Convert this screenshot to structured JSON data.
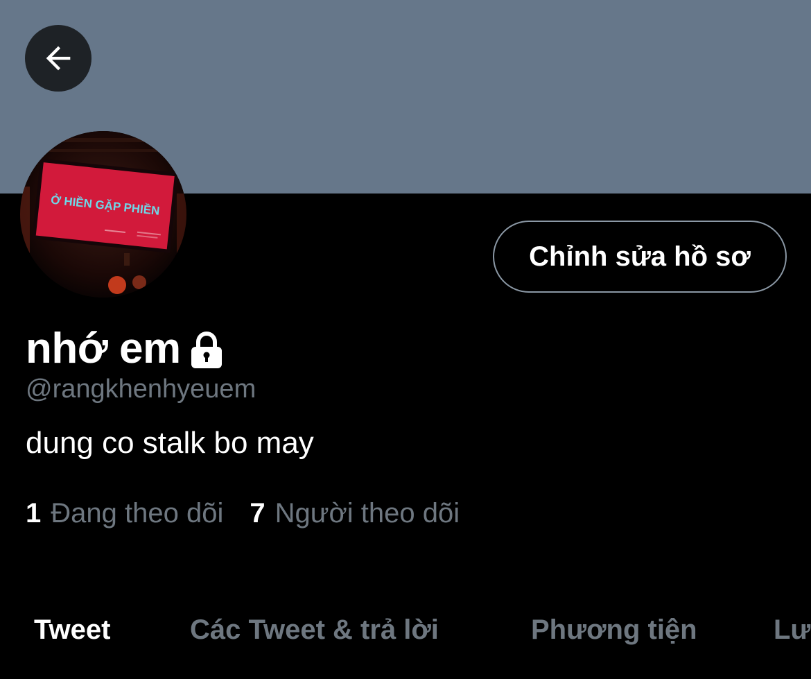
{
  "profile": {
    "display_name": "nhớ em",
    "handle": "@rangkhenhyeuem",
    "bio": "dung co stalk bo may",
    "protected_icon": "lock-icon",
    "avatar_sign_text": "Ở HIỀN GẶP PHIỀN"
  },
  "header": {
    "back_icon": "arrow-left-icon",
    "banner_color": "#66778a"
  },
  "actions": {
    "edit_profile_label": "Chỉnh sửa hồ sơ"
  },
  "stats": {
    "following_count": "1",
    "following_label": "Đang theo dõi",
    "followers_count": "7",
    "followers_label": "Người theo dõi"
  },
  "tabs": [
    {
      "label": "Tweet",
      "active": true
    },
    {
      "label": "Các Tweet & trả lời",
      "active": false
    },
    {
      "label": "Phương tiện",
      "active": false
    },
    {
      "label": "Lượt thích",
      "active": false
    }
  ],
  "colors": {
    "background": "#000000",
    "text_primary": "#ffffff",
    "text_secondary": "#6e7780",
    "button_border": "#8b98a5"
  }
}
